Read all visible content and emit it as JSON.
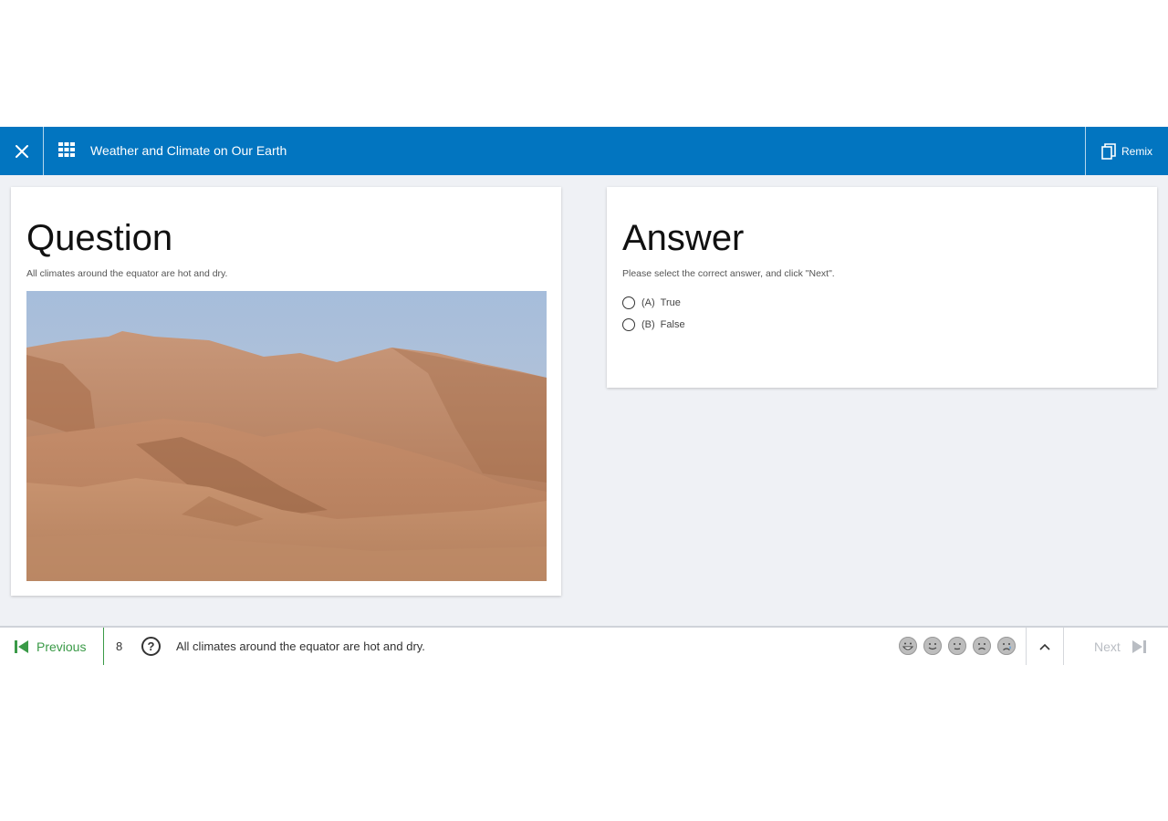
{
  "header": {
    "title": "Weather and Climate on Our Earth",
    "remix_label": "Remix"
  },
  "question": {
    "heading": "Question",
    "text": "All climates around the equator are hot and dry."
  },
  "answer": {
    "heading": "Answer",
    "instruction": "Please select the correct answer, and click \"Next\".",
    "options": [
      {
        "letter": "(A)",
        "label": "True"
      },
      {
        "letter": "(B)",
        "label": "False"
      }
    ]
  },
  "footer": {
    "previous_label": "Previous",
    "question_number": "8",
    "question_text": "All climates around the equator are hot and dry.",
    "next_label": "Next"
  },
  "colors": {
    "header_blue": "#0275c0",
    "previous_green": "#3a9a47",
    "next_disabled": "#b9bdc3"
  },
  "icons": [
    "close-icon",
    "grid-icon",
    "remix-copy-icon",
    "skip-previous-icon",
    "help-icon",
    "very-happy-face-icon",
    "happy-face-icon",
    "neutral-face-icon",
    "sad-face-icon",
    "crying-face-icon",
    "chevron-up-icon",
    "skip-next-icon"
  ]
}
